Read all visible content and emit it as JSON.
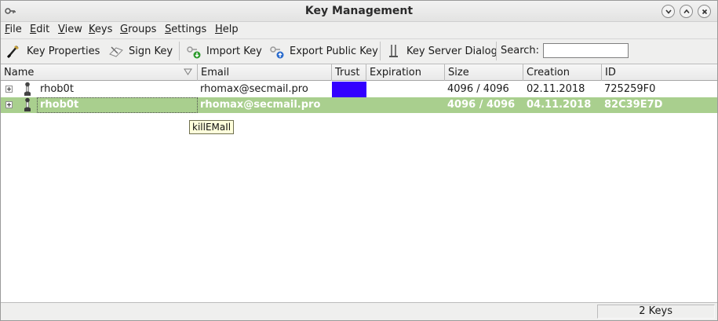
{
  "window": {
    "title": "Key Management"
  },
  "menu": [
    {
      "label": "File",
      "key": "F",
      "rest": "ile"
    },
    {
      "label": "Edit",
      "key": "E",
      "rest": "dit"
    },
    {
      "label": "View",
      "key": "V",
      "rest": "iew"
    },
    {
      "label": "Keys",
      "key": "K",
      "rest": "eys"
    },
    {
      "label": "Groups",
      "key": "G",
      "rest": "roups"
    },
    {
      "label": "Settings",
      "key": "S",
      "rest": "ettings"
    },
    {
      "label": "Help",
      "key": "H",
      "rest": "elp"
    }
  ],
  "toolbar": {
    "key_properties": "Key Properties",
    "sign_key": "Sign Key",
    "import_key": "Import Key",
    "export_public_key": "Export Public Key",
    "key_server_dialog": "Key Server Dialog",
    "search_label": "Search:",
    "search_value": ""
  },
  "table": {
    "columns": [
      "Name",
      "Email",
      "Trust",
      "Expiration",
      "Size",
      "Creation",
      "ID"
    ],
    "rows": [
      {
        "name": "rhob0t",
        "email": "rhomax@secmail.pro",
        "trust_color": "#3300ff",
        "expiration": "",
        "size": "4096 / 4096",
        "creation": "02.11.2018",
        "id": "725259F0"
      },
      {
        "name": "rhob0t",
        "email": "rhomax@secmail.pro",
        "trust_color": "",
        "expiration": "",
        "size": "4096 / 4096",
        "creation": "04.11.2018",
        "id": "82C39E7D"
      }
    ]
  },
  "tooltip": "killEMaIl",
  "status": {
    "key_count": "2 Keys"
  },
  "colors": {
    "selection": "#a9cf8e",
    "trust_ultimate": "#3300ff"
  }
}
